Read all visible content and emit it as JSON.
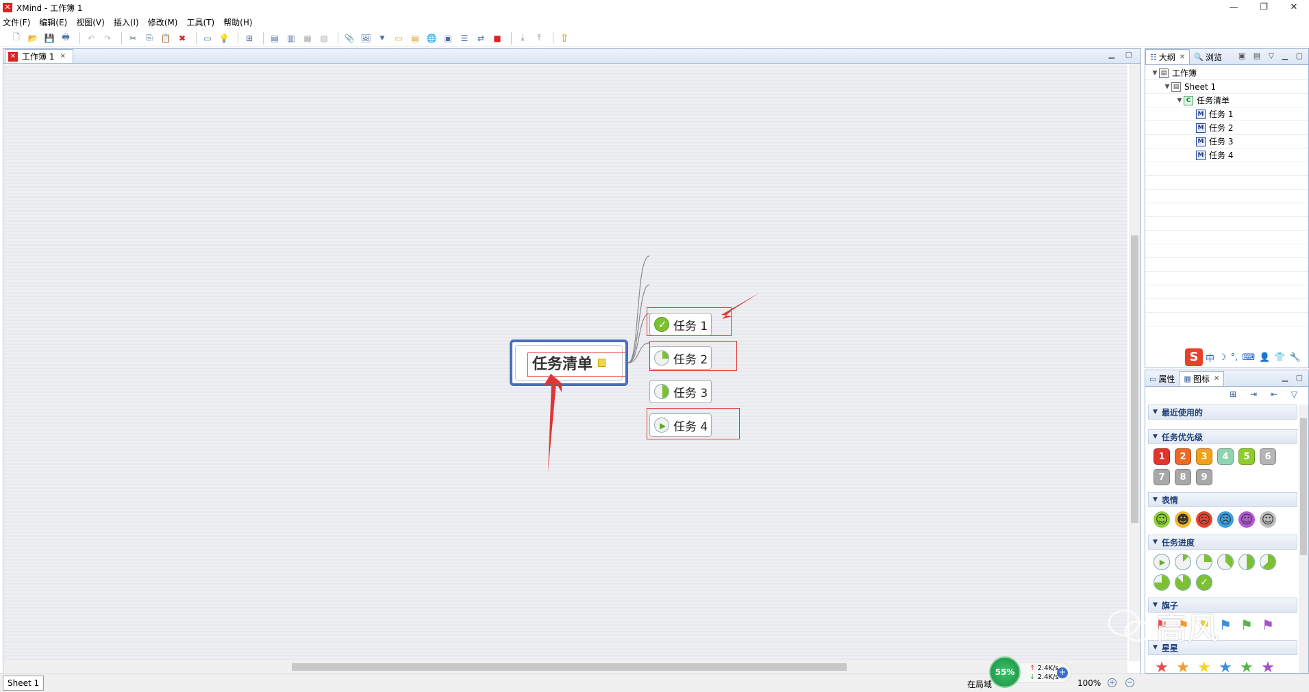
{
  "window": {
    "title": "XMind - 工作簿 1"
  },
  "menu": [
    "文件(F)",
    "编辑(E)",
    "视图(V)",
    "插入(I)",
    "修改(M)",
    "工具(T)",
    "帮助(H)"
  ],
  "editor": {
    "tab_label": "工作簿 1"
  },
  "map": {
    "central": "任务清单",
    "topics": [
      {
        "label": "任务 1",
        "marker": "task-done-icon",
        "progress": 1.0
      },
      {
        "label": "任务 2",
        "marker": "task-quarter-icon",
        "progress": 0.25
      },
      {
        "label": "任务 3",
        "marker": "task-half-icon",
        "progress": 0.5
      },
      {
        "label": "任务 4",
        "marker": "task-start-icon",
        "progress": 0
      }
    ]
  },
  "outline": {
    "tab_outline": "大纲",
    "tab_browse": "浏览",
    "tree": {
      "workbook": "工作簿",
      "sheet": "Sheet 1",
      "central": "任务清单",
      "children": [
        "任务 1",
        "任务 2",
        "任务 3",
        "任务 4"
      ]
    }
  },
  "ime": {
    "logo": "S",
    "mode": "中"
  },
  "icons_panel": {
    "tab_properties": "属性",
    "tab_icons": "图标",
    "groups": {
      "recent": "最近使用的",
      "priority": "任务优先级",
      "faces": "表情",
      "progress": "任务进度",
      "flags": "旗子",
      "stars": "星星"
    },
    "priority_numbers": [
      "1",
      "2",
      "3",
      "4",
      "5",
      "6",
      "7",
      "8",
      "9"
    ],
    "priority_colors": [
      "#e0342b",
      "#ee6a23",
      "#f2a019",
      "#8fd4b0",
      "#8fcc2e",
      "#b5b5b5",
      "#a8a8a8",
      "#a8a8a8",
      "#a8a8a8"
    ],
    "progress_levels": [
      0,
      0.125,
      0.25,
      0.375,
      0.5,
      0.625,
      0.75,
      0.875,
      1.0
    ],
    "flag_colors": [
      "#e84b4b",
      "#f29b2e",
      "#f5d02a",
      "#3c8fd9",
      "#56b548",
      "#a54fd1"
    ],
    "star_colors": [
      "#e84b4b",
      "#f29b2e",
      "#f5d02a",
      "#3c8fd9",
      "#56b548",
      "#a54fd1"
    ]
  },
  "status": {
    "sheet_tab": "Sheet 1",
    "text": "在局域",
    "zoom": "100%",
    "net_percent": "55%",
    "upload": "2.4K/s",
    "download": "2.4K/s"
  },
  "watermark": {
    "text": "高风"
  },
  "colors": {
    "accent": "#4a6cc0",
    "annotation_red": "#e03535",
    "connector": "#888888",
    "progress_green": "#7cc132"
  }
}
